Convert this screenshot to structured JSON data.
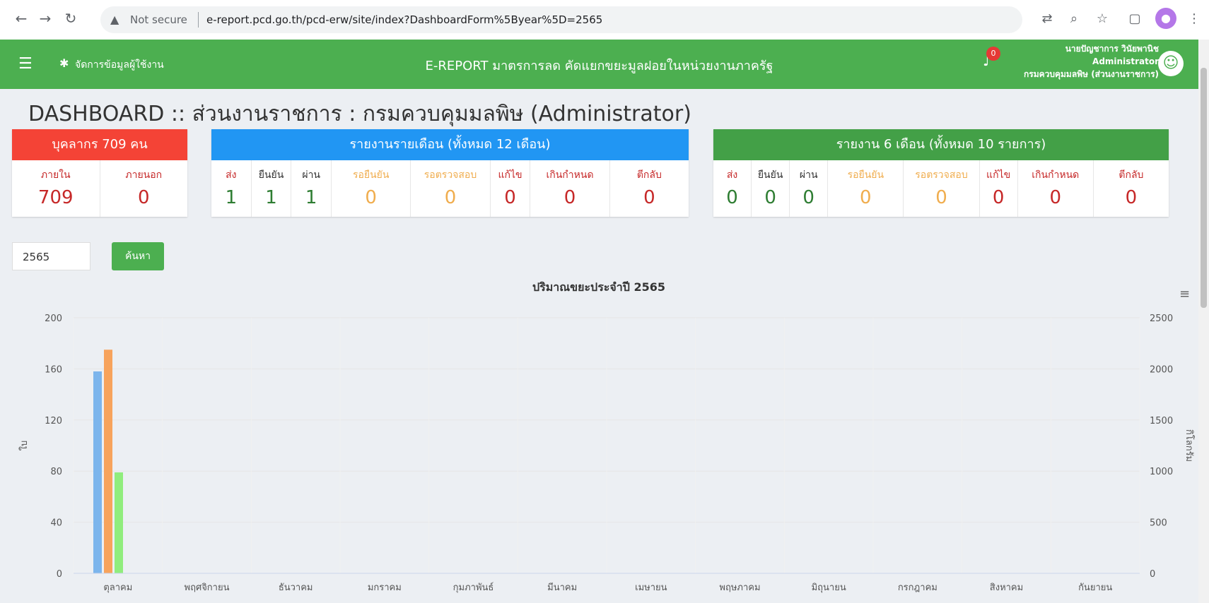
{
  "browser": {
    "warning": "Not secure",
    "url": "e-report.pcd.go.th/pcd-erw/site/index?DashboardForm%5Byear%5D=2565"
  },
  "header": {
    "user_settings": "จัดการข้อมูลผู้ใช้งาน",
    "title": "E-REPORT มาตรการลด คัดแยกขยะมูลฝอยในหน่วยงานภาครัฐ",
    "notifications": "0",
    "user_name": "นายปัญชาการ วินัยพานิช",
    "user_role": "Administrator",
    "user_org": "กรมควบคุมมลพิษ (ส่วนงานราชการ)"
  },
  "page_title": "DASHBOARD :: ส่วนงานราชการ : กรมควบคุมมลพิษ (Administrator)",
  "cards": {
    "personnel": {
      "title": "บุคลากร 709 คน",
      "cols": [
        {
          "label": "ภายใน",
          "value": "709"
        },
        {
          "label": "ภายนอก",
          "value": "0"
        }
      ]
    },
    "monthly": {
      "title": "รายงานรายเดือน (ทั้งหมด 12 เดือน)",
      "cols": [
        {
          "label": "ส่ง",
          "value": "1"
        },
        {
          "label": "ยืนยัน",
          "value": "1"
        },
        {
          "label": "ผ่าน",
          "value": "1"
        },
        {
          "label": "รอยืนยัน",
          "value": "0"
        },
        {
          "label": "รอตรวจสอบ",
          "value": "0"
        },
        {
          "label": "แก้ไข",
          "value": "0"
        },
        {
          "label": "เกินกำหนด",
          "value": "0"
        },
        {
          "label": "ตีกลับ",
          "value": "0"
        }
      ]
    },
    "six_month": {
      "title": "รายงาน 6 เดือน (ทั้งหมด 10 รายการ)",
      "cols": [
        {
          "label": "ส่ง",
          "value": "0"
        },
        {
          "label": "ยืนยัน",
          "value": "0"
        },
        {
          "label": "ผ่าน",
          "value": "0"
        },
        {
          "label": "รอยืนยัน",
          "value": "0"
        },
        {
          "label": "รอตรวจสอบ",
          "value": "0"
        },
        {
          "label": "แก้ไข",
          "value": "0"
        },
        {
          "label": "เกินกำหนด",
          "value": "0"
        },
        {
          "label": "ตีกลับ",
          "value": "0"
        }
      ]
    }
  },
  "filter": {
    "year": "2565",
    "search_label": "ค้นหา"
  },
  "chart_data": {
    "type": "bar",
    "title": "ปริมาณขยะประจำปี 2565",
    "ylabel": "ใบ",
    "y2label": "กิโลกรัม",
    "ylim": [
      0,
      200
    ],
    "y2lim": [
      0,
      2500
    ],
    "yticks": [
      "0",
      "40",
      "80",
      "120",
      "160",
      "200"
    ],
    "y2ticks": [
      "0",
      "500",
      "1000",
      "1500",
      "2000",
      "2500"
    ],
    "categories": [
      "ตุลาคม",
      "พฤศจิกายน",
      "ธันวาคม",
      "มกราคม",
      "กุมภาพันธ์",
      "มีนาคม",
      "เมษายน",
      "พฤษภาคม",
      "มิถุนายน",
      "กรกฎาคม",
      "สิงหาคม",
      "กันยายน"
    ],
    "series": [
      {
        "color": "#7cb5ec",
        "values": [
          158,
          0,
          0,
          0,
          0,
          0,
          0,
          0,
          0,
          0,
          0,
          0
        ]
      },
      {
        "color": "#f7a35c",
        "values": [
          175,
          0,
          0,
          0,
          0,
          0,
          0,
          0,
          0,
          0,
          0,
          0
        ]
      },
      {
        "color": "#90ed7d",
        "values": [
          79,
          0,
          0,
          0,
          0,
          0,
          0,
          0,
          0,
          0,
          0,
          0
        ]
      }
    ],
    "grid": true
  },
  "colors": {
    "green": "#4caf50",
    "red": "#f44336",
    "blue": "#2196f3",
    "value_red": "#c62828",
    "value_green": "#2e7d32",
    "value_orange": "#f0ad4e"
  }
}
